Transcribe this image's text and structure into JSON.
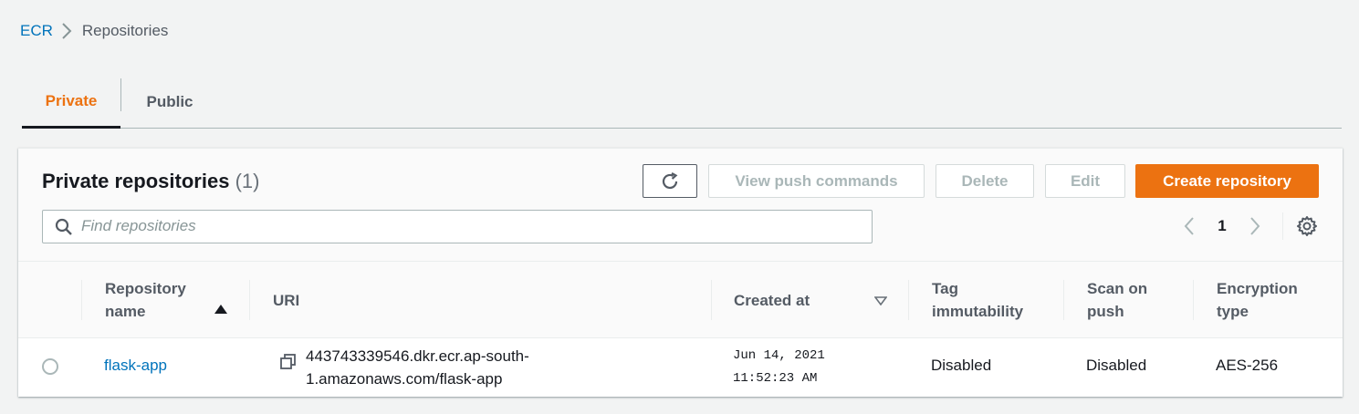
{
  "breadcrumb": {
    "root": "ECR",
    "current": "Repositories"
  },
  "tabs": {
    "private": "Private",
    "public": "Public"
  },
  "panel": {
    "title": "Private repositories",
    "count": "(1)",
    "buttons": {
      "refresh_icon": "refresh-icon",
      "view_push": "View push commands",
      "delete": "Delete",
      "edit": "Edit",
      "create": "Create repository"
    },
    "search": {
      "placeholder": "Find repositories"
    },
    "pagination": {
      "page": "1"
    }
  },
  "table": {
    "columns": {
      "name": [
        "Repository",
        "name"
      ],
      "uri": "URI",
      "created": "Created at",
      "tag": [
        "Tag",
        "immutability"
      ],
      "scan": [
        "Scan on",
        "push"
      ],
      "enc": [
        "Encryption",
        "type"
      ]
    },
    "rows": [
      {
        "name": "flask-app",
        "uri_line1": "443743339546.dkr.ecr.ap-south-",
        "uri_line2": "1.amazonaws.com/flask-app",
        "created_line1": "Jun 14, 2021",
        "created_line2": "11:52:23 AM",
        "tag_immutability": "Disabled",
        "scan_on_push": "Disabled",
        "encryption_type": "AES-256"
      }
    ]
  },
  "colors": {
    "accent": "#ec7211",
    "link": "#0073bb"
  }
}
